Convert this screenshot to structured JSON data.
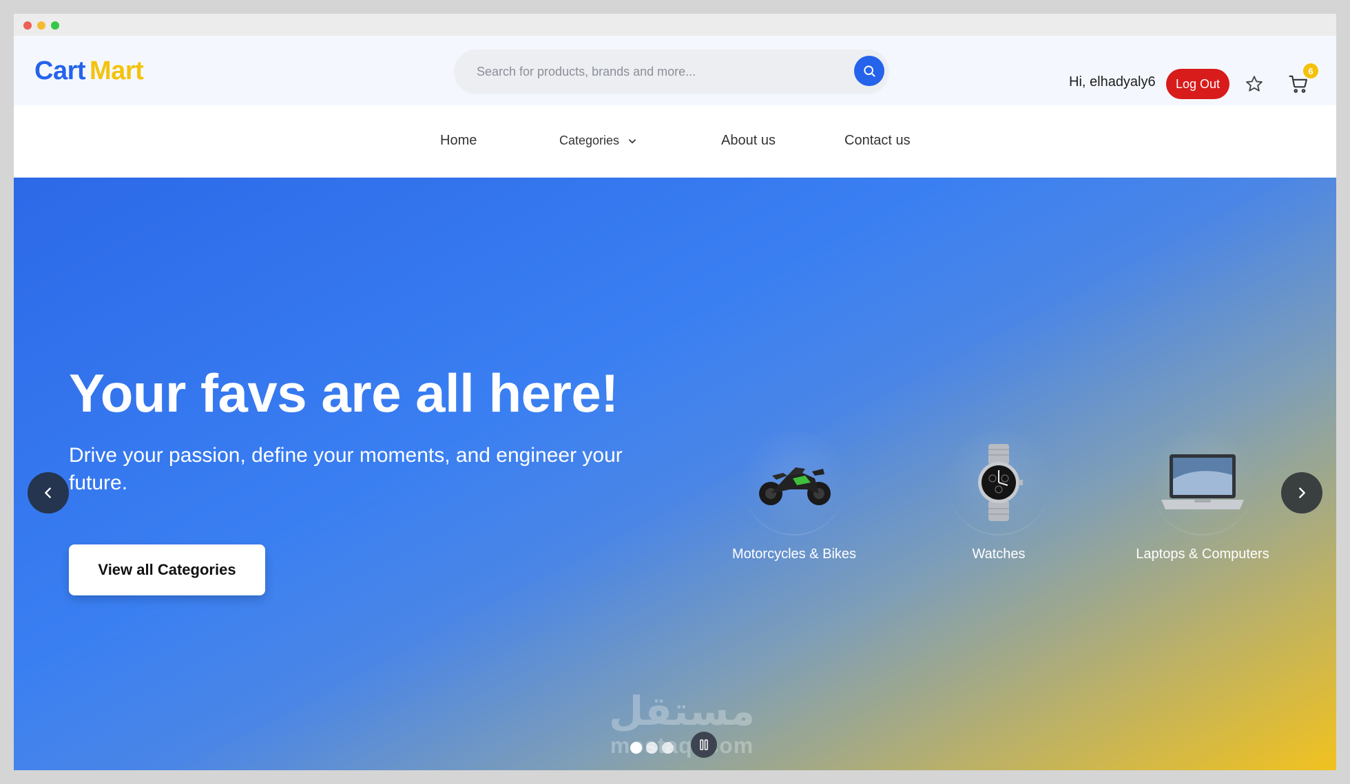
{
  "brand": {
    "part1": "Cart",
    "part2": "Mart",
    "color1": "#2563eb",
    "color2": "#f4c20d"
  },
  "search": {
    "placeholder": "Search for products, brands and more...",
    "value": ""
  },
  "user": {
    "greeting": "Hi, elhadyaly6",
    "logout_label": "Log Out",
    "cart_count": "6"
  },
  "nav": {
    "home": "Home",
    "categories": "Categories",
    "about": "About us",
    "contact": "Contact us"
  },
  "hero": {
    "title": "Your favs are all here!",
    "subtitle": "Drive your passion, define your moments, and engineer your future.",
    "cta_label": "View all Categories",
    "categories": [
      {
        "label": "Motorcycles & Bikes",
        "icon": "motorcycle-icon"
      },
      {
        "label": "Watches",
        "icon": "watch-icon"
      },
      {
        "label": "Laptops & Computers",
        "icon": "laptop-icon"
      }
    ],
    "slide_count": 3,
    "active_slide": 1
  },
  "watermark": {
    "arabic": "مستقل",
    "latin": "mostaql.com"
  },
  "colors": {
    "primary": "#2563eb",
    "accent": "#f4c20d",
    "danger": "#d81b1b"
  }
}
